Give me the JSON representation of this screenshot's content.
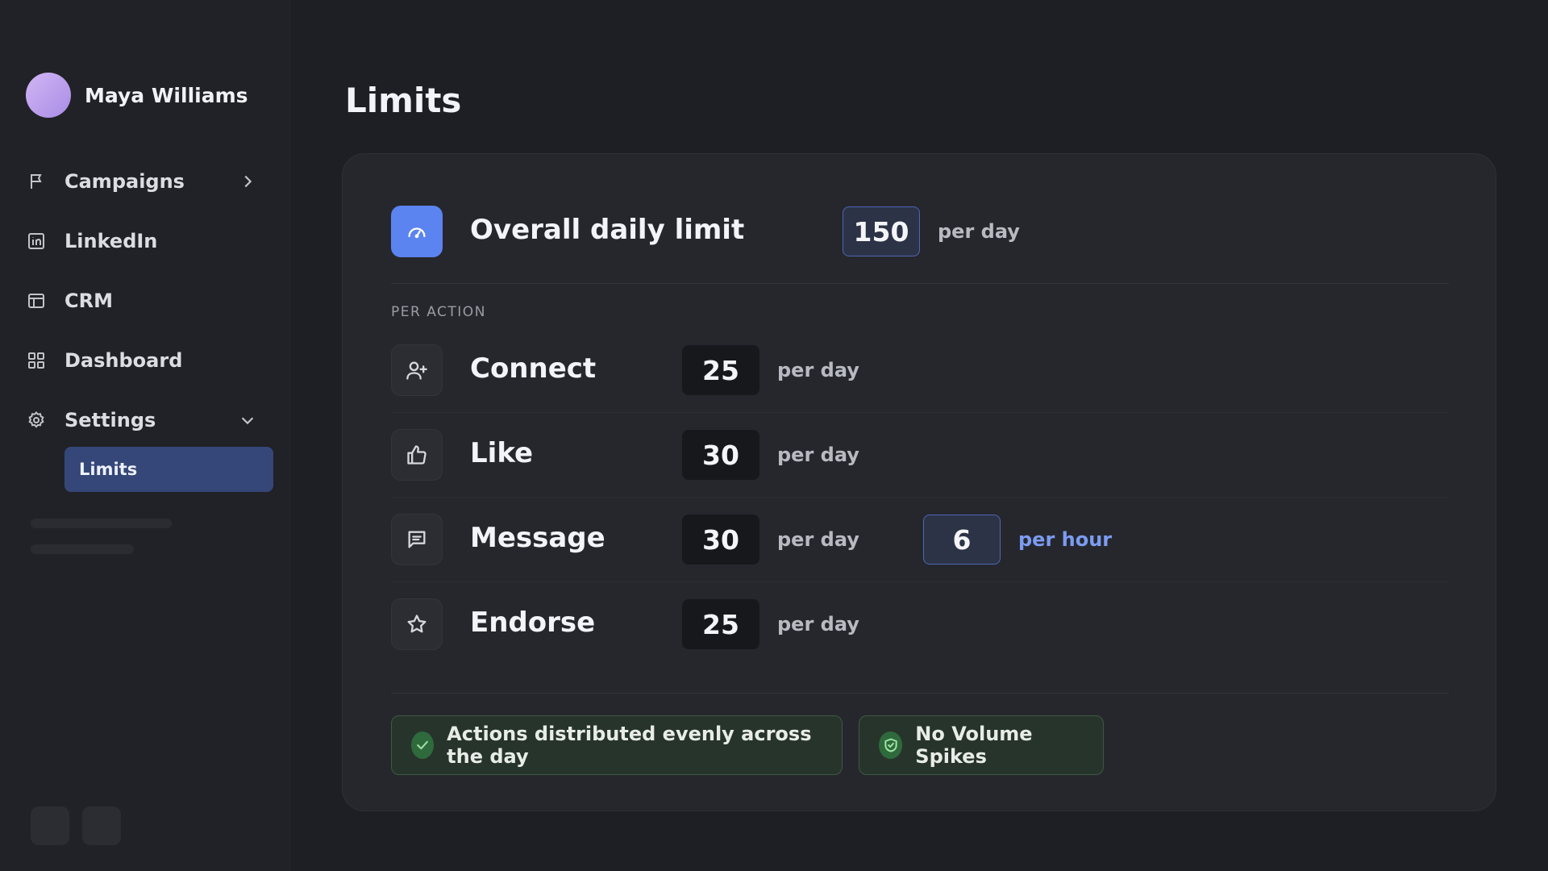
{
  "profile": {
    "name": "Maya Williams"
  },
  "nav": {
    "items": [
      {
        "label": "Campaigns",
        "icon": "flag-icon"
      },
      {
        "label": "LinkedIn",
        "icon": "linkedin-icon"
      },
      {
        "label": "CRM",
        "icon": "table-icon"
      },
      {
        "label": "Dashboard",
        "icon": "grid-icon"
      },
      {
        "label": "Settings",
        "icon": "gear-icon"
      }
    ],
    "sub_items": [
      {
        "label": "Limits"
      }
    ]
  },
  "page": {
    "title": "Limits"
  },
  "overall": {
    "label": "Overall daily limit",
    "value": "150",
    "unit": "per day",
    "icon": "gauge-icon"
  },
  "section": {
    "label": "PER ACTION"
  },
  "actions": [
    {
      "label": "Connect",
      "value": "25",
      "unit": "per day",
      "icon": "user-plus-icon"
    },
    {
      "label": "Like",
      "value": "30",
      "unit": "per day",
      "icon": "thumbs-up-icon"
    },
    {
      "label": "Message",
      "value": "30",
      "unit": "per day",
      "hourly_value": "6",
      "hourly_unit": "per hour",
      "icon": "message-icon"
    },
    {
      "label": "Endorse",
      "value": "25",
      "unit": "per day",
      "icon": "star-icon"
    }
  ],
  "badges": [
    {
      "label": "Actions distributed evenly across the day",
      "icon": "check-icon"
    },
    {
      "label": "No Volume Spikes",
      "icon": "shield-check-icon"
    }
  ],
  "colors": {
    "accent": "#5b84f0",
    "active_nav": "#354778",
    "success_bg": "#27342b",
    "success_icon": "#2f6a3c"
  }
}
